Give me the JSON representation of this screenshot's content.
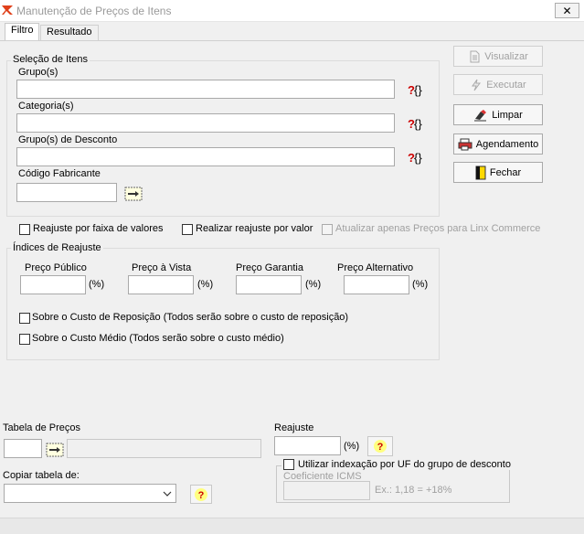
{
  "window": {
    "title": "Manutenção de Preços de Itens",
    "close_glyph": "✕"
  },
  "tabs": [
    {
      "label": "Filtro",
      "active": true
    },
    {
      "label": "Resultado",
      "active": false
    }
  ],
  "selecao": {
    "legend": "Seleção de Itens",
    "grupos_label": "Grupo(s)",
    "categoria_label": "Categoria(s)",
    "desconto_label": "Grupo(s) de Desconto",
    "fabricante_label": "Código Fabricante",
    "help_text": "?{}"
  },
  "actions": {
    "visualizar": "Visualizar",
    "executar": "Executar",
    "limpar": "Limpar",
    "agendamento": "Agendamento",
    "fechar": "Fechar"
  },
  "options": {
    "reajuste_faixa": "Reajuste por faixa de valores",
    "reajuste_valor": "Realizar reajuste por valor",
    "linx_commerce": "Atualizar apenas Preços para Linx Commerce"
  },
  "indices": {
    "legend": "Índices de Reajuste",
    "preco_publico": "Preço Público",
    "preco_vista": "Preço à Vista",
    "preco_garantia": "Preço Garantia",
    "preco_alternativo": "Preço Alternativo",
    "pct": "(%)",
    "custo_reposicao": "Sobre o Custo de Reposição (Todos serão sobre o custo de reposição)",
    "custo_medio": "Sobre o Custo Médio (Todos serão sobre o custo médio)"
  },
  "bottom": {
    "tabela_precos": "Tabela de Preços",
    "copiar_tabela": "Copiar tabela de:",
    "reajuste": "Reajuste",
    "pct": "(%)",
    "help_q": "?",
    "indexacao_uf": "Utilizar indexação por UF do grupo de desconto",
    "coeficiente_icms": "Coeficiente ICMS",
    "exemplo": "Ex.: 1,18 = +18%"
  },
  "colors": {
    "help_yellow": "#ffff80",
    "help_red": "#cc0000"
  }
}
